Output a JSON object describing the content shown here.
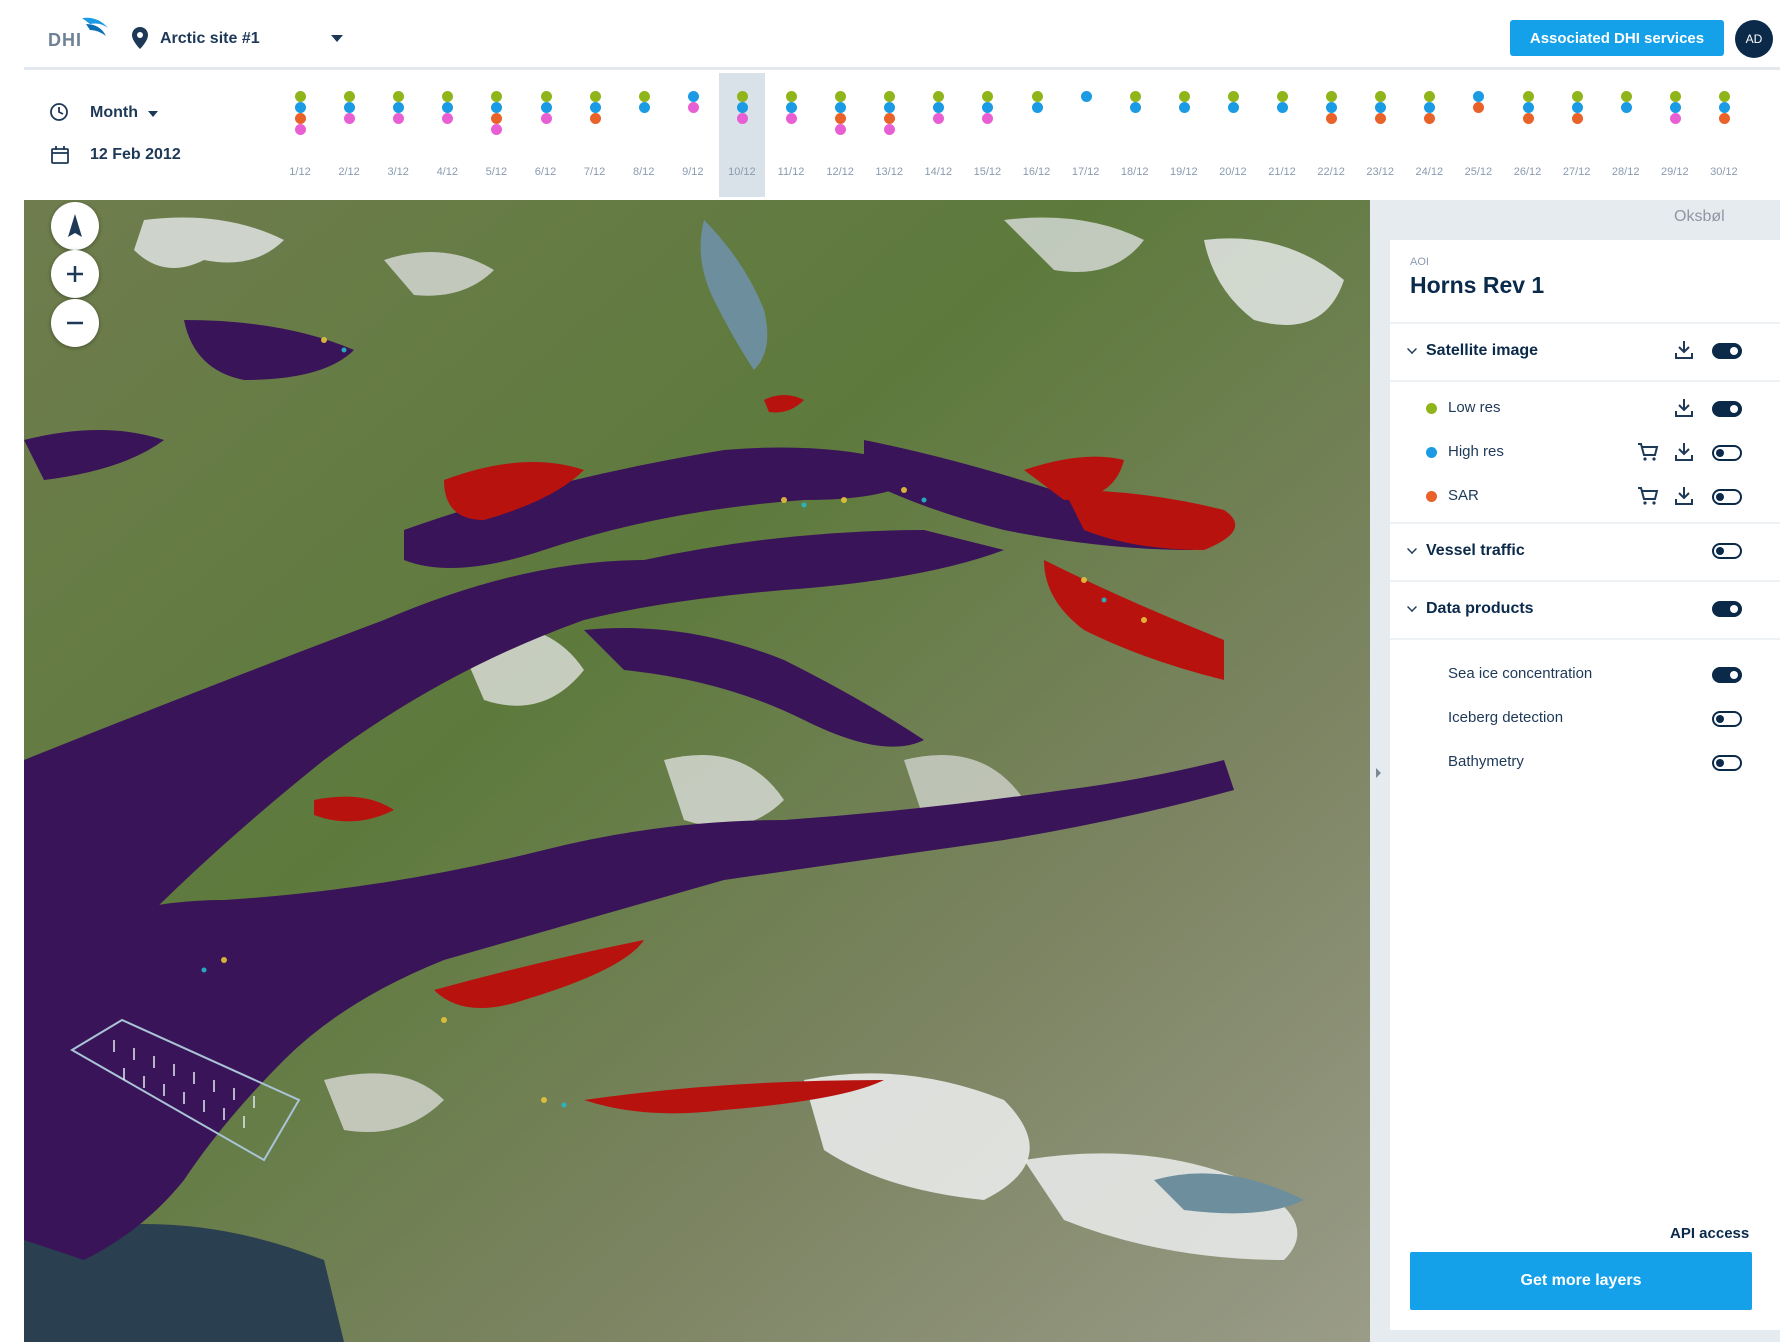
{
  "header": {
    "logo_text": "DHI",
    "site_label": "Arctic site #1",
    "associated_button": "Associated DHI services",
    "avatar_initials": "AD"
  },
  "timebar": {
    "period_label": "Month",
    "date_label": "12 Feb 2012",
    "selected_day": "10/12",
    "days": [
      {
        "label": "1/12",
        "dots": [
          "low",
          "high",
          "sar",
          "pink"
        ]
      },
      {
        "label": "2/12",
        "dots": [
          "low",
          "high",
          "pink"
        ]
      },
      {
        "label": "3/12",
        "dots": [
          "low",
          "high",
          "pink"
        ]
      },
      {
        "label": "4/12",
        "dots": [
          "low",
          "high",
          "pink"
        ]
      },
      {
        "label": "5/12",
        "dots": [
          "low",
          "high",
          "sar",
          "pink"
        ]
      },
      {
        "label": "6/12",
        "dots": [
          "low",
          "high",
          "pink"
        ]
      },
      {
        "label": "7/12",
        "dots": [
          "low",
          "high",
          "sar"
        ]
      },
      {
        "label": "8/12",
        "dots": [
          "low",
          "high"
        ]
      },
      {
        "label": "9/12",
        "dots": [
          "high",
          "pink"
        ]
      },
      {
        "label": "10/12",
        "dots": [
          "low",
          "high",
          "pink"
        ]
      },
      {
        "label": "11/12",
        "dots": [
          "low",
          "high",
          "pink"
        ]
      },
      {
        "label": "12/12",
        "dots": [
          "low",
          "high",
          "sar",
          "pink"
        ]
      },
      {
        "label": "13/12",
        "dots": [
          "low",
          "high",
          "sar",
          "pink"
        ]
      },
      {
        "label": "14/12",
        "dots": [
          "low",
          "high",
          "pink"
        ]
      },
      {
        "label": "15/12",
        "dots": [
          "low",
          "high",
          "pink"
        ]
      },
      {
        "label": "16/12",
        "dots": [
          "low",
          "high"
        ]
      },
      {
        "label": "17/12",
        "dots": [
          "high"
        ]
      },
      {
        "label": "18/12",
        "dots": [
          "low",
          "high"
        ]
      },
      {
        "label": "19/12",
        "dots": [
          "low",
          "high"
        ]
      },
      {
        "label": "20/12",
        "dots": [
          "low",
          "high"
        ]
      },
      {
        "label": "21/12",
        "dots": [
          "low",
          "high"
        ]
      },
      {
        "label": "22/12",
        "dots": [
          "low",
          "high",
          "sar"
        ]
      },
      {
        "label": "23/12",
        "dots": [
          "low",
          "high",
          "sar"
        ]
      },
      {
        "label": "24/12",
        "dots": [
          "low",
          "high",
          "sar"
        ]
      },
      {
        "label": "25/12",
        "dots": [
          "high",
          "sar"
        ]
      },
      {
        "label": "26/12",
        "dots": [
          "low",
          "high",
          "sar"
        ]
      },
      {
        "label": "27/12",
        "dots": [
          "low",
          "high",
          "sar"
        ]
      },
      {
        "label": "28/12",
        "dots": [
          "low",
          "high"
        ]
      },
      {
        "label": "29/12",
        "dots": [
          "low",
          "high",
          "pink"
        ]
      },
      {
        "label": "30/12",
        "dots": [
          "low",
          "high",
          "sar"
        ]
      }
    ]
  },
  "map": {
    "corner_label": "Oksbøl",
    "controls": [
      "north-arrow",
      "zoom-in",
      "zoom-out"
    ]
  },
  "panel": {
    "aoi_small": "AOI",
    "aoi_title": "Horns Rev 1",
    "satellite": {
      "title": "Satellite image",
      "enabled": true,
      "items": [
        {
          "label": "Low res",
          "color": "#8fb51b",
          "enabled": true,
          "cart": false
        },
        {
          "label": "High res",
          "color": "#1a9be3",
          "enabled": false,
          "cart": true
        },
        {
          "label": "SAR",
          "color": "#e8622a",
          "enabled": false,
          "cart": true
        }
      ]
    },
    "vessel": {
      "title": "Vessel traffic",
      "enabled": false
    },
    "products": {
      "title": "Data products",
      "enabled": true,
      "items": [
        {
          "label": "Sea ice concentration",
          "enabled": true
        },
        {
          "label": "Iceberg detection",
          "enabled": false
        },
        {
          "label": "Bathymetry",
          "enabled": false
        }
      ]
    },
    "api_label": "API access",
    "more_button": "Get more layers"
  },
  "colors": {
    "accent": "#14a1ea",
    "navy": "#0b2a4a",
    "low_res": "#8fb51b",
    "high_res": "#1a9be3",
    "sar": "#e8622a",
    "extra": "#e85fd4",
    "sea_ice_low": "#3a1458",
    "sea_ice_high": "#b8120f"
  }
}
